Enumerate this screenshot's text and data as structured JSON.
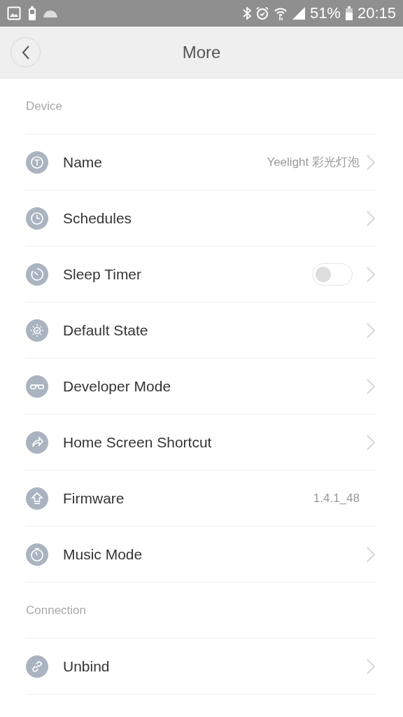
{
  "status_bar": {
    "battery_percent": "51%",
    "time": "20:15"
  },
  "header": {
    "title": "More"
  },
  "sections": [
    {
      "title": "Device",
      "rows": [
        {
          "label": "Name",
          "value": "Yeelight 彩光灯泡",
          "chevron": true
        },
        {
          "label": "Schedules",
          "chevron": true
        },
        {
          "label": "Sleep Timer",
          "switch": {
            "on": false
          },
          "chevron": true
        },
        {
          "label": "Default State",
          "chevron": true
        },
        {
          "label": "Developer Mode",
          "chevron": true
        },
        {
          "label": "Home Screen Shortcut",
          "chevron": true
        },
        {
          "label": "Firmware",
          "value": "1.4.1_48",
          "chevron": false
        },
        {
          "label": "Music Mode",
          "chevron": true
        }
      ]
    },
    {
      "title": "Connection",
      "rows": [
        {
          "label": "Unbind",
          "chevron": true
        }
      ]
    }
  ]
}
